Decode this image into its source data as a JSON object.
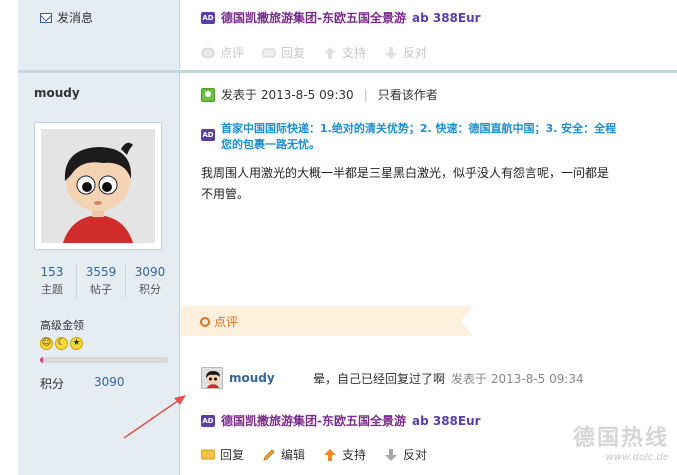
{
  "sidebar": {
    "send_message": "发消息",
    "username": "moudy",
    "stats": [
      {
        "value": "153",
        "label": "主题"
      },
      {
        "value": "3559",
        "label": "帖子"
      },
      {
        "value": "3090",
        "label": "积分"
      }
    ],
    "rank": "高级金领",
    "rank_progress": 0.02,
    "credit_label": "积分",
    "credit_value": "3090"
  },
  "ads": {
    "top": "德国凯撒旅游集团-东欧五国全景游",
    "top_suffix": "ab 388Eur",
    "badge": "AD",
    "block_line1": "首家中国国际快递：1.绝对的清关优势；2. 快速：德国直航中国；3. 安全：全程",
    "block_line2": "您的包裹一路无忧。",
    "bottom": "德国凯撒旅游集团-东欧五国全景游",
    "bottom_suffix": "ab 388Eur"
  },
  "top_actions": [
    "点评",
    "回复",
    "支持",
    "反对"
  ],
  "post": {
    "posted_label": "发表于 2013-8-5 09:30",
    "only_author": "只看该作者",
    "body_line1": "我周围人用激光的大概一半都是三星黑白激光，似乎没人有怨言呢，一问都是",
    "body_line2": "不用管。"
  },
  "comments_section": {
    "title": "点评",
    "items": [
      {
        "user": "moudy",
        "text": "晕，自己已经回复过了啊",
        "time": "发表于 2013-8-5 09:34"
      }
    ]
  },
  "bottom_actions": [
    "回复",
    "编辑",
    "支持",
    "反对"
  ],
  "watermark": {
    "title": "德国热线",
    "url": "www.dolc.de"
  },
  "colors": {
    "sidebar_bg": "#e5edf2",
    "link_blue": "#336699",
    "ad_purple": "#7a2a8c",
    "ad_blue": "#1e90d0",
    "comment_orange": "#e07020",
    "arrow_red": "#e0524a"
  }
}
